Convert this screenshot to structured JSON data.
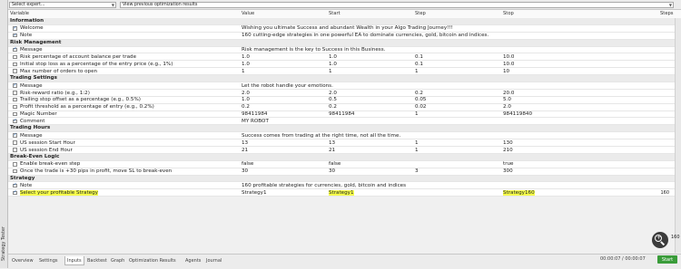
{
  "side_label": "Strategy Tester",
  "top": {
    "expert_select": "Select expert...",
    "view_link": "View previous optimization results"
  },
  "columns": [
    "Variable",
    "Value",
    "Start",
    "Step",
    "Stop",
    "Steps"
  ],
  "rows": [
    {
      "type": "section",
      "title": "Information"
    },
    {
      "name": "Welcome",
      "checked": true,
      "value": "Wishing you ultimate Success and abundant Wealth in your Algo Trading Journey!!!",
      "start": "",
      "step": "",
      "stop": ""
    },
    {
      "name": "Note",
      "checked": true,
      "value": "160 cutting-edge strategies in one powerful EA to dominate currencies, gold, bitcoin and indices.",
      "start": "",
      "step": "",
      "stop": ""
    },
    {
      "type": "section",
      "title": "Risk Management"
    },
    {
      "name": "Message",
      "checked": true,
      "value": "Risk management is the key to Success in this Business.",
      "start": "",
      "step": "",
      "stop": ""
    },
    {
      "name": "Risk percentage of account balance per trade",
      "checked": false,
      "value": "1.0",
      "start": "1.0",
      "step": "0.1",
      "stop": "10.0"
    },
    {
      "name": "Initial stop loss as a percentage of the entry price (e.g., 1%)",
      "checked": false,
      "value": "1.0",
      "start": "1.0",
      "step": "0.1",
      "stop": "10.0"
    },
    {
      "name": "Max number of orders to open",
      "checked": false,
      "value": "1",
      "start": "1",
      "step": "1",
      "stop": "10"
    },
    {
      "type": "section",
      "title": "Trading Settings"
    },
    {
      "name": "Message",
      "checked": true,
      "value": "Let the robot handle your emotions.",
      "start": "",
      "step": "",
      "stop": ""
    },
    {
      "name": "Risk-reward ratio (e.g., 1:2)",
      "checked": false,
      "value": "2.0",
      "start": "2.0",
      "step": "0.2",
      "stop": "20.0"
    },
    {
      "name": "Trailing stop offset as a percentage (e.g., 0.5%)",
      "checked": false,
      "value": "1.0",
      "start": "0.5",
      "step": "0.05",
      "stop": "5.0"
    },
    {
      "name": "Profit threshold as a percentage of entry (e.g., 0.2%)",
      "checked": false,
      "value": "0.2",
      "start": "0.2",
      "step": "0.02",
      "stop": "2.0"
    },
    {
      "name": "Magic Number",
      "checked": false,
      "value": "98411984",
      "start": "98411984",
      "step": "1",
      "stop": "984119840"
    },
    {
      "name": "Comment",
      "checked": true,
      "value": "MY ROBOT",
      "start": "",
      "step": "",
      "stop": ""
    },
    {
      "type": "section",
      "title": "Trading Hours"
    },
    {
      "name": "Message",
      "checked": true,
      "value": "Success comes from trading at the right time, not all the time.",
      "start": "",
      "step": "",
      "stop": ""
    },
    {
      "name": "US session Start Hour",
      "checked": false,
      "value": "13",
      "start": "13",
      "step": "1",
      "stop": "130"
    },
    {
      "name": "US session End Hour",
      "checked": false,
      "value": "21",
      "start": "21",
      "step": "1",
      "stop": "210"
    },
    {
      "type": "section",
      "title": "Break-Even Logic"
    },
    {
      "name": "Enable break-even step",
      "checked": false,
      "value": "false",
      "start": "false",
      "step": "",
      "stop": "true"
    },
    {
      "name": "Once the trade is +30 pips in profit, move SL to break-even",
      "checked": false,
      "value": "30",
      "start": "30",
      "step": "3",
      "stop": "300"
    },
    {
      "type": "section",
      "title": "Strategy"
    },
    {
      "name": "Note",
      "checked": true,
      "value": "160 profitable strategies for currencies, gold, bitcoin and indices",
      "start": "",
      "step": "",
      "stop": ""
    },
    {
      "name": "Select your profitable Strategy",
      "checked": true,
      "value": "Strategy1",
      "start": "Strategy1",
      "step": "",
      "stop": "Strategy160",
      "highlight": true,
      "steps": "160"
    }
  ],
  "last_steps": "160",
  "tabs": [
    "Overview",
    "Settings",
    "Inputs",
    "Backtest",
    "Graph",
    "Optimization Results",
    "Agents",
    "Journal"
  ],
  "active_tab": "Inputs",
  "time": "00:00:07 / 00:00:07",
  "start_button": "Start",
  "zoom_icon": "zoom-in-icon"
}
